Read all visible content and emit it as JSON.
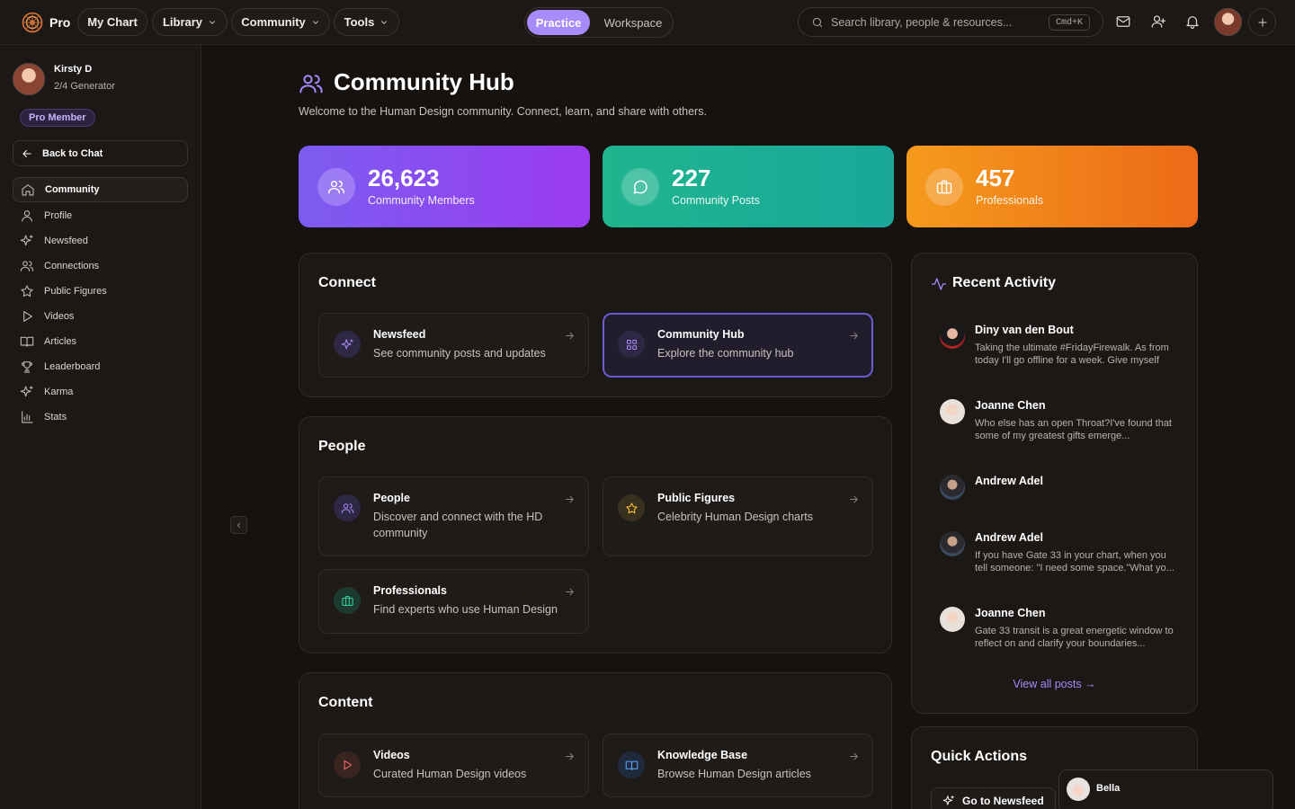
{
  "brand": {
    "name": "Pro"
  },
  "topnav": {
    "my_chart": "My Chart",
    "library": "Library",
    "community": "Community",
    "tools": "Tools",
    "mode_active": "Practice",
    "mode_inactive": "Workspace",
    "search_placeholder": "Search library, people & resources...",
    "search_shortcut": "Cmd+K"
  },
  "user": {
    "name": "Kirsty D",
    "type": "2/4 Generator",
    "badge": "Pro Member"
  },
  "sidebar": {
    "back": "Back to Chat",
    "items": [
      {
        "label": "Community",
        "icon": "home-icon"
      },
      {
        "label": "Profile",
        "icon": "user-icon"
      },
      {
        "label": "Newsfeed",
        "icon": "sparkles-icon"
      },
      {
        "label": "Connections",
        "icon": "users-icon"
      },
      {
        "label": "Public Figures",
        "icon": "star-icon"
      },
      {
        "label": "Videos",
        "icon": "play-icon"
      },
      {
        "label": "Articles",
        "icon": "book-icon"
      },
      {
        "label": "Leaderboard",
        "icon": "trophy-icon"
      },
      {
        "label": "Karma",
        "icon": "sparkles-icon"
      },
      {
        "label": "Stats",
        "icon": "bar-chart-icon"
      }
    ]
  },
  "page": {
    "title": "Community Hub",
    "subtitle": "Welcome to the Human Design community. Connect, learn, and share with others."
  },
  "stats": [
    {
      "value": "26,623",
      "label": "Community Members",
      "color": "#8b5cf6"
    },
    {
      "value": "227",
      "label": "Community Posts",
      "color": "#14b8a6"
    },
    {
      "value": "457",
      "label": "Professionals",
      "color": "#f97316"
    }
  ],
  "sections": {
    "connect": {
      "title": "Connect",
      "cards": [
        {
          "title": "Newsfeed",
          "desc": "See community posts and updates"
        },
        {
          "title": "Community Hub",
          "desc": "Explore the community hub"
        }
      ]
    },
    "people": {
      "title": "People",
      "cards": [
        {
          "title": "People",
          "desc": "Discover and connect with the HD community"
        },
        {
          "title": "Public Figures",
          "desc": "Celebrity Human Design charts"
        },
        {
          "title": "Professionals",
          "desc": "Find experts who use Human Design"
        }
      ]
    },
    "content": {
      "title": "Content",
      "cards": [
        {
          "title": "Videos",
          "desc": "Curated Human Design videos"
        },
        {
          "title": "Knowledge Base",
          "desc": "Browse Human Design articles"
        }
      ]
    }
  },
  "activity": {
    "title": "Recent Activity",
    "items": [
      {
        "name": "Diny van den Bout",
        "text": "Taking the ultimate #FridayFirewalk. As from today I'll go offline for a week. Give myself a..."
      },
      {
        "name": "Joanne Chen",
        "text": "Who else has an open Throat?I've found that some of my greatest gifts emerge..."
      },
      {
        "name": "Andrew Adel",
        "text": ""
      },
      {
        "name": "Andrew Adel",
        "text": "If you have Gate 33 in your chart, when you tell someone: \"I need some space.\"What yo..."
      },
      {
        "name": "Joanne Chen",
        "text": "Gate 33 transit is a great energetic window to reflect on and clarify your boundaries..."
      }
    ],
    "view_all": "View all posts →"
  },
  "quick_actions": {
    "title": "Quick Actions",
    "newsfeed": "Go to Newsfeed"
  },
  "assistant": {
    "name": "Bella"
  },
  "colors": {
    "accent": "#a78bfa",
    "background": "#161210"
  }
}
